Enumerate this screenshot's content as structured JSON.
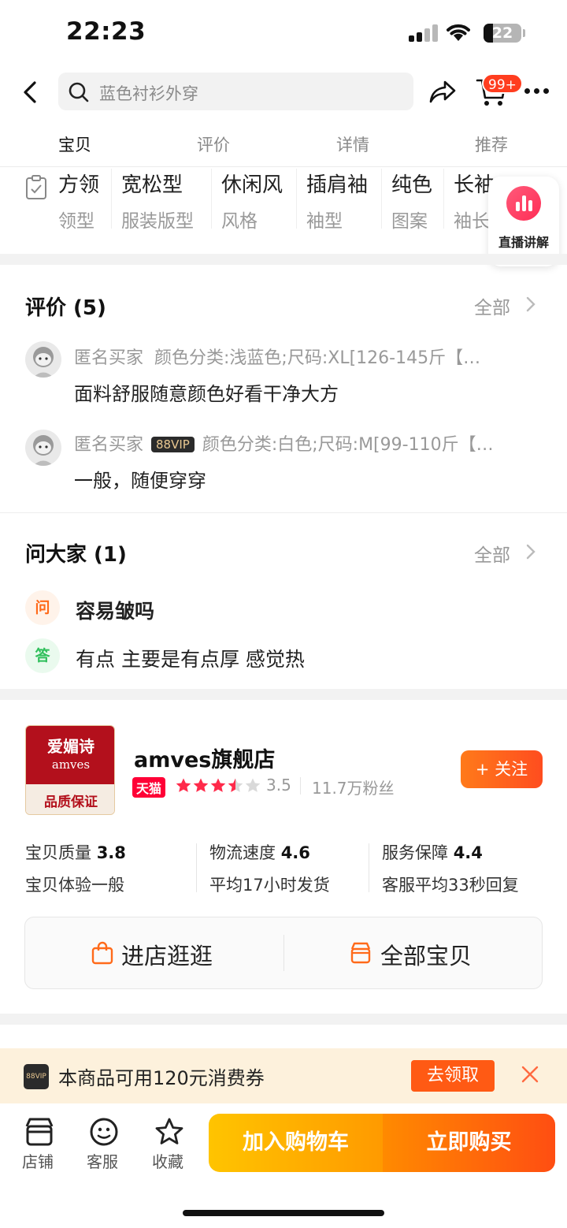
{
  "status_bar": {
    "time": "22:23",
    "battery": "22"
  },
  "nav": {
    "search_placeholder": "蓝色衬衫外穿",
    "cart_badge": "99+"
  },
  "tabs": [
    {
      "label": "宝贝",
      "active": true
    },
    {
      "label": "评价",
      "active": false
    },
    {
      "label": "详情",
      "active": false
    },
    {
      "label": "推荐",
      "active": false
    }
  ],
  "params": [
    {
      "value": "方领",
      "key": "领型"
    },
    {
      "value": "宽松型",
      "key": "服装版型"
    },
    {
      "value": "休闲风",
      "key": "风格"
    },
    {
      "value": "插肩袖",
      "key": "袖型"
    },
    {
      "value": "纯色",
      "key": "图案"
    },
    {
      "value": "长袖",
      "key": "袖长"
    }
  ],
  "live_label": "直播讲解",
  "reviews": {
    "title": "评价 (5)",
    "more": "全部",
    "items": [
      {
        "user": "匿名买家",
        "vip": "",
        "spec": "颜色分类:浅蓝色;尺码:XL[126-145斤【…",
        "text": "面料舒服随意颜色好看干净大方"
      },
      {
        "user": "匿名买家",
        "vip": "88VIP",
        "spec": "颜色分类:白色;尺码:M[99-110斤【…",
        "text": "一般，随便穿穿"
      }
    ]
  },
  "ask": {
    "title": "问大家 (1)",
    "more": "全部",
    "q_icon": "问",
    "a_icon": "答",
    "question": "容易皱吗",
    "answer": "有点 主要是有点厚 感觉热"
  },
  "shop": {
    "logo_brand": "爱媚诗",
    "logo_en": "amves",
    "logo_tag": "品质保证",
    "name": "amves旗舰店",
    "tmall": "天猫",
    "stars": 3.5,
    "rating": "3.5",
    "fans": "11.7万粉丝",
    "follow": "+ 关注",
    "scores": [
      {
        "label": "宝贝质量",
        "value": "3.8",
        "desc": "宝贝体验一般"
      },
      {
        "label": "物流速度",
        "value": "4.6",
        "desc": "平均17小时发货"
      },
      {
        "label": "服务保障",
        "value": "4.4",
        "desc": "客服平均33秒回复"
      }
    ],
    "enter_store": "进店逛逛",
    "all_items": "全部宝贝"
  },
  "coupon": {
    "badge": "88VIP",
    "text": "本商品可用120元消费券",
    "action": "去领取"
  },
  "bottom": {
    "store": "店铺",
    "service": "客服",
    "favorite": "收藏",
    "add_cart": "加入购物车",
    "buy_now": "立即购买"
  },
  "colors": {
    "accent": "#ff5000",
    "tmall": "#ff0036",
    "cart_yellow": "#ffb000",
    "buy_orange": "#ff5a12"
  }
}
